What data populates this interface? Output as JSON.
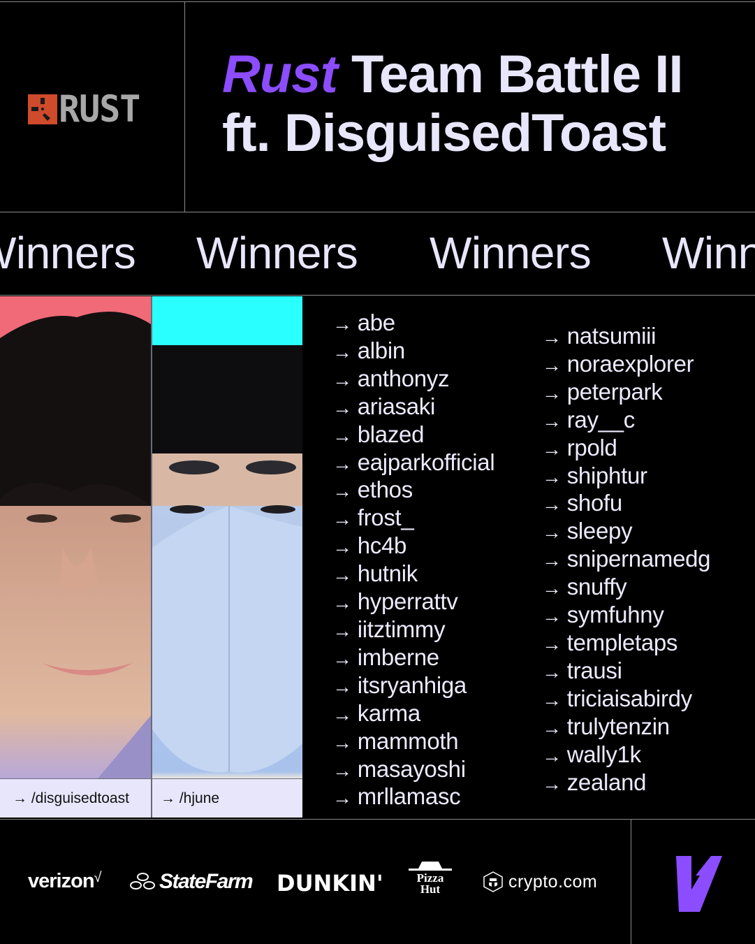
{
  "header": {
    "brand_logo_text": "RUST",
    "title_accent": "Rust",
    "title_rest_line1": " Team Battle II",
    "title_line2": "ft. DisguisedToast"
  },
  "marquee": {
    "words": [
      "Winners",
      "Winners",
      "Winners",
      "Winners"
    ]
  },
  "featured": [
    {
      "handle": "→ /disguisedtoast",
      "photo_description": "portrait of smiling person with black hair on pink background"
    },
    {
      "handle": "→ /hjune",
      "photo_description": "portrait of person in black beanie and blue face mask on cyan background"
    }
  ],
  "winners": {
    "arrow": "→",
    "column_1": [
      "abe",
      "albin",
      "anthonyz",
      "ariasaki",
      "blazed",
      "eajparkofficial",
      "ethos",
      "frost_",
      "hc4b",
      "hutnik",
      "hyperrattv",
      "iitztimmy",
      "imberne",
      "itsryanhiga",
      "karma",
      "mammoth",
      "masayoshi",
      "mrllamasc"
    ],
    "column_2": [
      "natsumiii",
      "noraexplorer",
      "peterpark",
      "ray__c",
      "rpold",
      "shiphtur",
      "shofu",
      "sleepy",
      "snipernamedg",
      "snuffy",
      "symfuhny",
      "templetaps",
      "trausi",
      "triciaisabirdy",
      "trulytenzin",
      "wally1k",
      "zealand"
    ]
  },
  "sponsors": {
    "verizon": "verizon",
    "verizon_check": "√",
    "statefarm": "StateFarm",
    "dunkin": "DUNKIN'",
    "pizzahut_line1": "Pizza",
    "pizzahut_line2": "Hut",
    "crypto": "crypto.com"
  },
  "colors": {
    "accent": "#8b4dff",
    "text": "#e8e6fb",
    "rust_red": "#d04a2c",
    "handle_bg": "#e7e6fb"
  }
}
